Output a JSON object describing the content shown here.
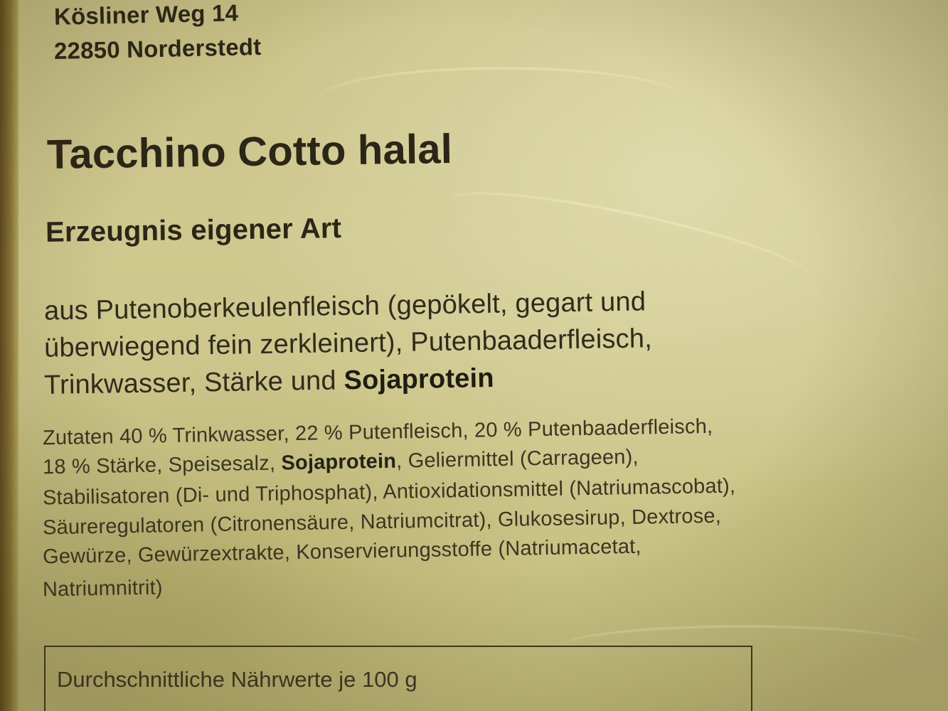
{
  "label": {
    "address": {
      "street": "Kösliner Weg 14",
      "city": "22850 Norderstedt"
    },
    "product_name": "Tacchino Cotto halal",
    "product_type": "Erzeugnis eigener Art",
    "description": {
      "line1": "aus Putenoberkeulenfleisch (gepökelt, gegart und",
      "line2": "überwiegend fein zerkleinert), Putenbaaderfleisch,",
      "line3_prefix": "Trinkwasser, Stärke und ",
      "line3_bold": "Sojaprotein"
    },
    "ingredients": {
      "line1": "Zutaten  40 % Trinkwasser, 22 % Putenfleisch, 20 % Putenbaaderfleisch,",
      "line2_prefix": "18 % Stärke, Speisesalz, ",
      "line2_bold": "Sojaprotein",
      "line2_suffix": ", Geliermittel (Carrageen),",
      "line3": "Stabilisatoren (Di- und Triphosphat), Antioxidationsmittel (Natriumascobat),",
      "line4": "Säureregulatoren (Citronensäure, Natriumcitrat), Glukosesirup, Dextrose,",
      "line5": "Gewürze, Gewürzextrakte, Konservierungsstoffe (Natriumacetat,",
      "line6": "Natriumnitrit)"
    },
    "nutrition_heading": "Durchschnittliche Nährwerte je 100 g"
  },
  "colors": {
    "paper": "#cfc88f",
    "ink": "#2a2618",
    "edge": "#6b5524"
  }
}
